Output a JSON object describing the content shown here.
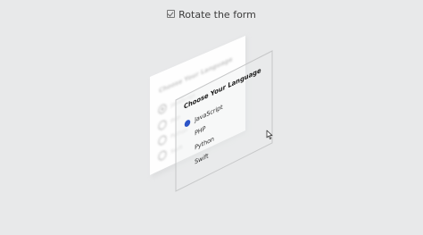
{
  "toggle": {
    "label": "Rotate the form",
    "checked": true
  },
  "form": {
    "title": "Choose Your Language",
    "selected": "JavaScript",
    "options": [
      "JavaScript",
      "PHP",
      "Python",
      "Swift"
    ]
  },
  "colors": {
    "accent": "#2d55c8",
    "background": "#e8e9ea"
  }
}
